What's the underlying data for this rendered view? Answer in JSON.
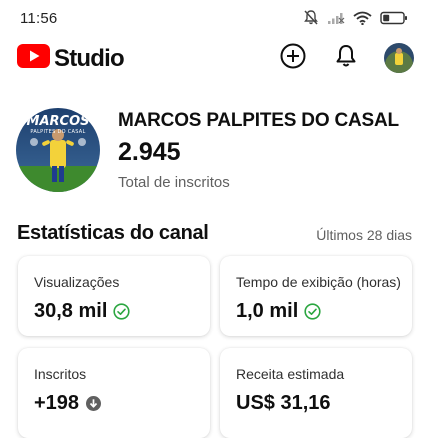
{
  "status_bar": {
    "time": "11:56",
    "icons": [
      "bell-off-icon",
      "signal-icon",
      "wifi-icon",
      "battery-icon"
    ]
  },
  "header": {
    "logo_text": "Studio",
    "actions": [
      "create-icon",
      "bell-icon",
      "avatar"
    ]
  },
  "channel": {
    "name": "MARCOS PALPITES DO CASAL",
    "subscribers": "2.945",
    "subscribers_label": "Total de inscritos",
    "avatar_caption": "MARCOS",
    "avatar_subcaption": "PALPITES DO CASAL"
  },
  "stats": {
    "title": "Estatísticas do canal",
    "period": "Últimos 28 dias",
    "cards": [
      {
        "label": "Visualizações",
        "value": "30,8 mil",
        "status_icon": "check-circle-icon"
      },
      {
        "label": "Tempo de exibição (horas)",
        "value": "1,0 mil",
        "status_icon": "check-circle-icon"
      },
      {
        "label": "Inscritos",
        "value": "+198",
        "status_icon": "arrow-down-circle-icon"
      },
      {
        "label": "Receita estimada",
        "value": "US$ 31,16",
        "status_icon": ""
      }
    ]
  },
  "colors": {
    "brand_red": "#ff0000",
    "success_green": "#2ba640",
    "muted_text": "#606060"
  }
}
